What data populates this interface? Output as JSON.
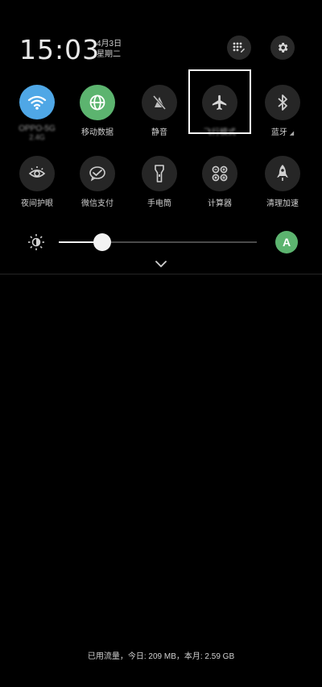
{
  "status": {
    "time": "15:03",
    "date_line1": "4月3日",
    "date_line2": "星期二"
  },
  "header_buttons": {
    "edit_icon": "grid-edit-icon",
    "settings_icon": "gear-icon"
  },
  "tiles_row1": [
    {
      "label": "OPPO-5G",
      "sublabel": "2.4G",
      "icon": "wifi-icon",
      "active": true,
      "color": "#4fa7e6"
    },
    {
      "label": "移动数据",
      "icon": "globe-icon",
      "active": true,
      "color": "#5cb46f"
    },
    {
      "label": "静音",
      "icon": "mute-icon",
      "active": false
    },
    {
      "label": "飞行模式",
      "icon": "airplane-icon",
      "active": false
    },
    {
      "label": "蓝牙",
      "icon": "bluetooth-icon",
      "active": false
    }
  ],
  "tiles_row2": [
    {
      "label": "夜间护眼",
      "icon": "eye-icon"
    },
    {
      "label": "微信支付",
      "icon": "wechat-pay-icon"
    },
    {
      "label": "手电筒",
      "icon": "flashlight-icon"
    },
    {
      "label": "计算器",
      "icon": "calculator-icon"
    },
    {
      "label": "清理加速",
      "icon": "rocket-icon"
    }
  ],
  "brightness": {
    "level": 0.22,
    "auto_label": "A",
    "auto_color": "#5cb46f"
  },
  "footer": {
    "data_usage": "已用流量，今日: 209 MB，本月: 2.59 GB"
  }
}
